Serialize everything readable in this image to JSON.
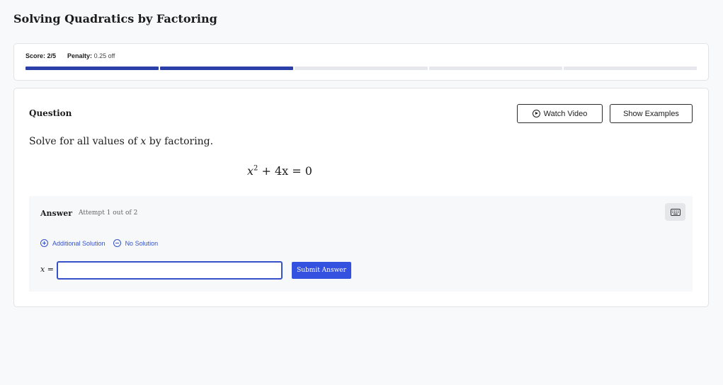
{
  "page": {
    "title": "Solving Quadratics by Factoring"
  },
  "score": {
    "score_label": "Score: 2/5",
    "penalty_label": "Penalty:",
    "penalty_value": "0.25 off",
    "progress": {
      "total": 5,
      "completed": 2
    },
    "colors": {
      "done": "#2b3fa8",
      "pending": "#e6e8ee"
    }
  },
  "question": {
    "label": "Question",
    "watch_video_label": "Watch Video",
    "show_examples_label": "Show Examples",
    "prompt_before": "Solve for all values of",
    "prompt_var": "x",
    "prompt_after": "by factoring.",
    "equation": {
      "var": "x",
      "exp": "2",
      "rest": "+ 4x = 0"
    }
  },
  "answer": {
    "label": "Answer",
    "attempt": "Attempt 1 out of 2",
    "additional_solution_label": "Additional Solution",
    "no_solution_label": "No Solution",
    "input_prefix": "x =",
    "input_value": "",
    "submit_label": "Submit Answer",
    "icons": {
      "keyboard": "keyboard-icon",
      "add": "plus-circle-icon",
      "none": "minus-circle-icon"
    },
    "accent_color": "#3551e0"
  }
}
